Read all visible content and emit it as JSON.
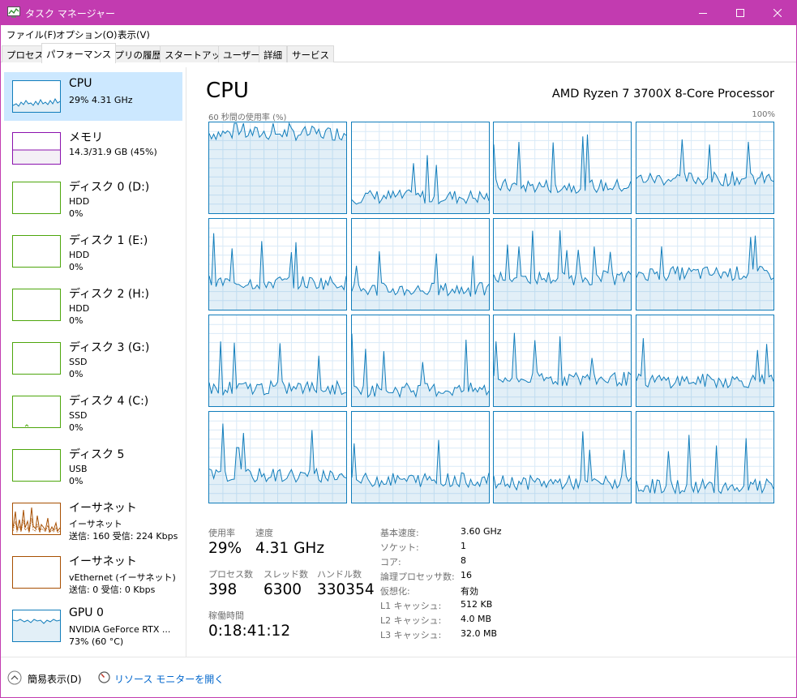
{
  "window": {
    "title": "タスク マネージャー"
  },
  "menu": {
    "file": "ファイル(F)",
    "options": "オプション(O)",
    "view": "表示(V)"
  },
  "tabs": [
    {
      "label": "プロセス"
    },
    {
      "label": "パフォーマンス",
      "active": true
    },
    {
      "label": "アプリの履歴"
    },
    {
      "label": "スタートアップ"
    },
    {
      "label": "ユーザー"
    },
    {
      "label": "詳細"
    },
    {
      "label": "サービス"
    }
  ],
  "sidebar": {
    "items": [
      {
        "name": "CPU",
        "line1": "29%  4.31 GHz",
        "line2": "",
        "line3": ""
      },
      {
        "name": "メモリ",
        "line1": "14.3/31.9 GB (45%)",
        "line2": "",
        "line3": ""
      },
      {
        "name": "ディスク 0 (D:)",
        "line1": "HDD",
        "line2": "0%",
        "line3": ""
      },
      {
        "name": "ディスク 1 (E:)",
        "line1": "HDD",
        "line2": "0%",
        "line3": ""
      },
      {
        "name": "ディスク 2 (H:)",
        "line1": "HDD",
        "line2": "0%",
        "line3": ""
      },
      {
        "name": "ディスク 3 (G:)",
        "line1": "SSD",
        "line2": "0%",
        "line3": ""
      },
      {
        "name": "ディスク 4 (C:)",
        "line1": "SSD",
        "line2": "0%",
        "line3": ""
      },
      {
        "name": "ディスク 5",
        "line1": "USB",
        "line2": "0%",
        "line3": ""
      },
      {
        "name": "イーサネット",
        "line1": "イーサネット",
        "line2": "送信: 160 受信: 224 Kbps",
        "line3": ""
      },
      {
        "name": "イーサネット",
        "line1": "vEthernet (イーサネット)",
        "line2": "送信: 0 受信: 0 Kbps",
        "line3": ""
      },
      {
        "name": "GPU 0",
        "line1": "NVIDIA GeForce RTX ...",
        "line2": "73% (60 °C)",
        "line3": ""
      }
    ]
  },
  "main": {
    "title": "CPU",
    "model": "AMD Ryzen 7 3700X 8-Core Processor",
    "graph_label": "60 秒間の使用率 (%)",
    "graph_max": "100%",
    "stats": {
      "utilization_label": "使用率",
      "utilization": "29%",
      "speed_label": "速度",
      "speed": "4.31 GHz",
      "processes_label": "プロセス数",
      "processes": "398",
      "threads_label": "スレッド数",
      "threads": "6300",
      "handles_label": "ハンドル数",
      "handles": "330354",
      "uptime_label": "稼働時間",
      "uptime": "0:18:41:12"
    },
    "specs": [
      {
        "label": "基本速度:",
        "value": "3.60 GHz"
      },
      {
        "label": "ソケット:",
        "value": "1"
      },
      {
        "label": "コア:",
        "value": "8"
      },
      {
        "label": "論理プロセッサ数:",
        "value": "16"
      },
      {
        "label": "仮想化:",
        "value": "有効"
      },
      {
        "label": "L1 キャッシュ:",
        "value": "512 KB"
      },
      {
        "label": "L2 キャッシュ:",
        "value": "4.0 MB"
      },
      {
        "label": "L3 キャッシュ:",
        "value": "32.0 MB"
      }
    ]
  },
  "footer": {
    "fewer_details": "簡易表示(D)",
    "resource_monitor": "リソース モニターを開く"
  },
  "colors": {
    "titlebar": "#c23bb0",
    "cpu": "#117dbb",
    "memory": "#8b12ae",
    "disk": "#4da60c",
    "ethernet": "#a74f01",
    "selected": "#cce8ff"
  }
}
